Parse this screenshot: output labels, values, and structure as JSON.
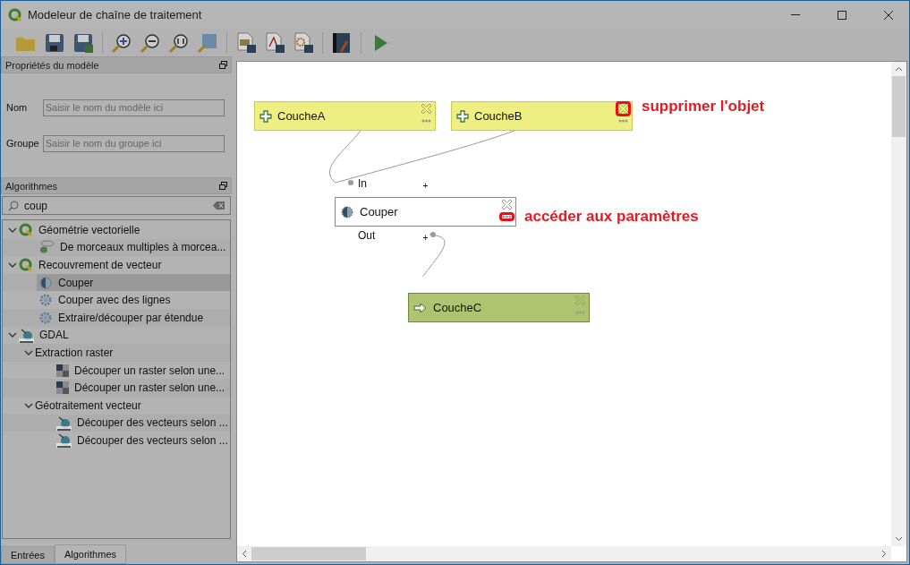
{
  "window": {
    "title": "Modeleur de chaîne de traitement"
  },
  "toolbar": [
    {
      "kind": "open"
    },
    {
      "kind": "save"
    },
    {
      "kind": "save-as"
    },
    {
      "kind": "sep"
    },
    {
      "kind": "zoom-in"
    },
    {
      "kind": "zoom-out"
    },
    {
      "kind": "zoom-actual"
    },
    {
      "kind": "zoom-full"
    },
    {
      "kind": "sep"
    },
    {
      "kind": "export-image"
    },
    {
      "kind": "export-pdf"
    },
    {
      "kind": "export-svg"
    },
    {
      "kind": "sep"
    },
    {
      "kind": "help"
    },
    {
      "kind": "sep"
    },
    {
      "kind": "run"
    }
  ],
  "model_properties": {
    "title": "Propriétés du modèle",
    "fields": [
      {
        "label": "Nom",
        "placeholder": "Saisir le nom du modèle ici"
      },
      {
        "label": "Groupe",
        "placeholder": "Saisir le nom du groupe ici"
      }
    ]
  },
  "algorithms": {
    "title": "Algorithmes",
    "search": {
      "value": "coup"
    },
    "tree": [
      {
        "label": "Géométrie vectorielle",
        "kind": "qgis",
        "expanded": true,
        "selected": false,
        "children": [
          {
            "label": "De morceaux multiples à morcea...",
            "kind": "multipart",
            "selected": false
          }
        ]
      },
      {
        "label": "Recouvrement de vecteur",
        "kind": "qgis",
        "expanded": true,
        "selected": false,
        "children": [
          {
            "label": "Couper",
            "kind": "clip",
            "selected": true
          },
          {
            "label": "Couper avec des lignes",
            "kind": "gear",
            "selected": false
          },
          {
            "label": "Extraire/découper par étendue",
            "kind": "gear",
            "selected": false
          }
        ]
      },
      {
        "label": "GDAL",
        "kind": "gdal",
        "expanded": true,
        "selected": false,
        "children": [
          {
            "label": "Extraction raster",
            "kind": "folder",
            "expanded": true,
            "selected": false,
            "children": [
              {
                "label": "Découper un raster selon une...",
                "kind": "raster",
                "selected": false
              },
              {
                "label": "Découper un raster selon une...",
                "kind": "raster",
                "selected": false
              }
            ]
          },
          {
            "label": "Géotraitement vecteur",
            "kind": "folder",
            "expanded": true,
            "selected": false,
            "children": [
              {
                "label": "Découper des vecteurs selon ...",
                "kind": "gdal",
                "selected": false
              },
              {
                "label": "Découper des vecteurs selon ...",
                "kind": "gdal",
                "selected": false
              }
            ]
          }
        ]
      }
    ]
  },
  "bottom_tabs": [
    {
      "label": "Entrées",
      "selected": false
    },
    {
      "label": "Algorithmes",
      "selected": true
    }
  ],
  "canvas": {
    "nodes": [
      {
        "kind": "input",
        "label": "CoucheA",
        "delete_highlighted": false,
        "params_highlighted": false
      },
      {
        "kind": "input",
        "label": "CoucheB",
        "delete_highlighted": true,
        "params_highlighted": false
      },
      {
        "kind": "algorithm",
        "label": "Couper",
        "delete_highlighted": false,
        "params_highlighted": true,
        "ports": [
          {
            "label": "In",
            "toggle": "+"
          },
          {
            "label": "Out",
            "toggle": "+"
          }
        ]
      },
      {
        "kind": "output",
        "label": "CoucheC",
        "delete_highlighted": false,
        "params_highlighted": false
      }
    ],
    "annotations": [
      {
        "text": "supprimer l'objet"
      },
      {
        "text": "accéder aux paramètres"
      }
    ]
  }
}
